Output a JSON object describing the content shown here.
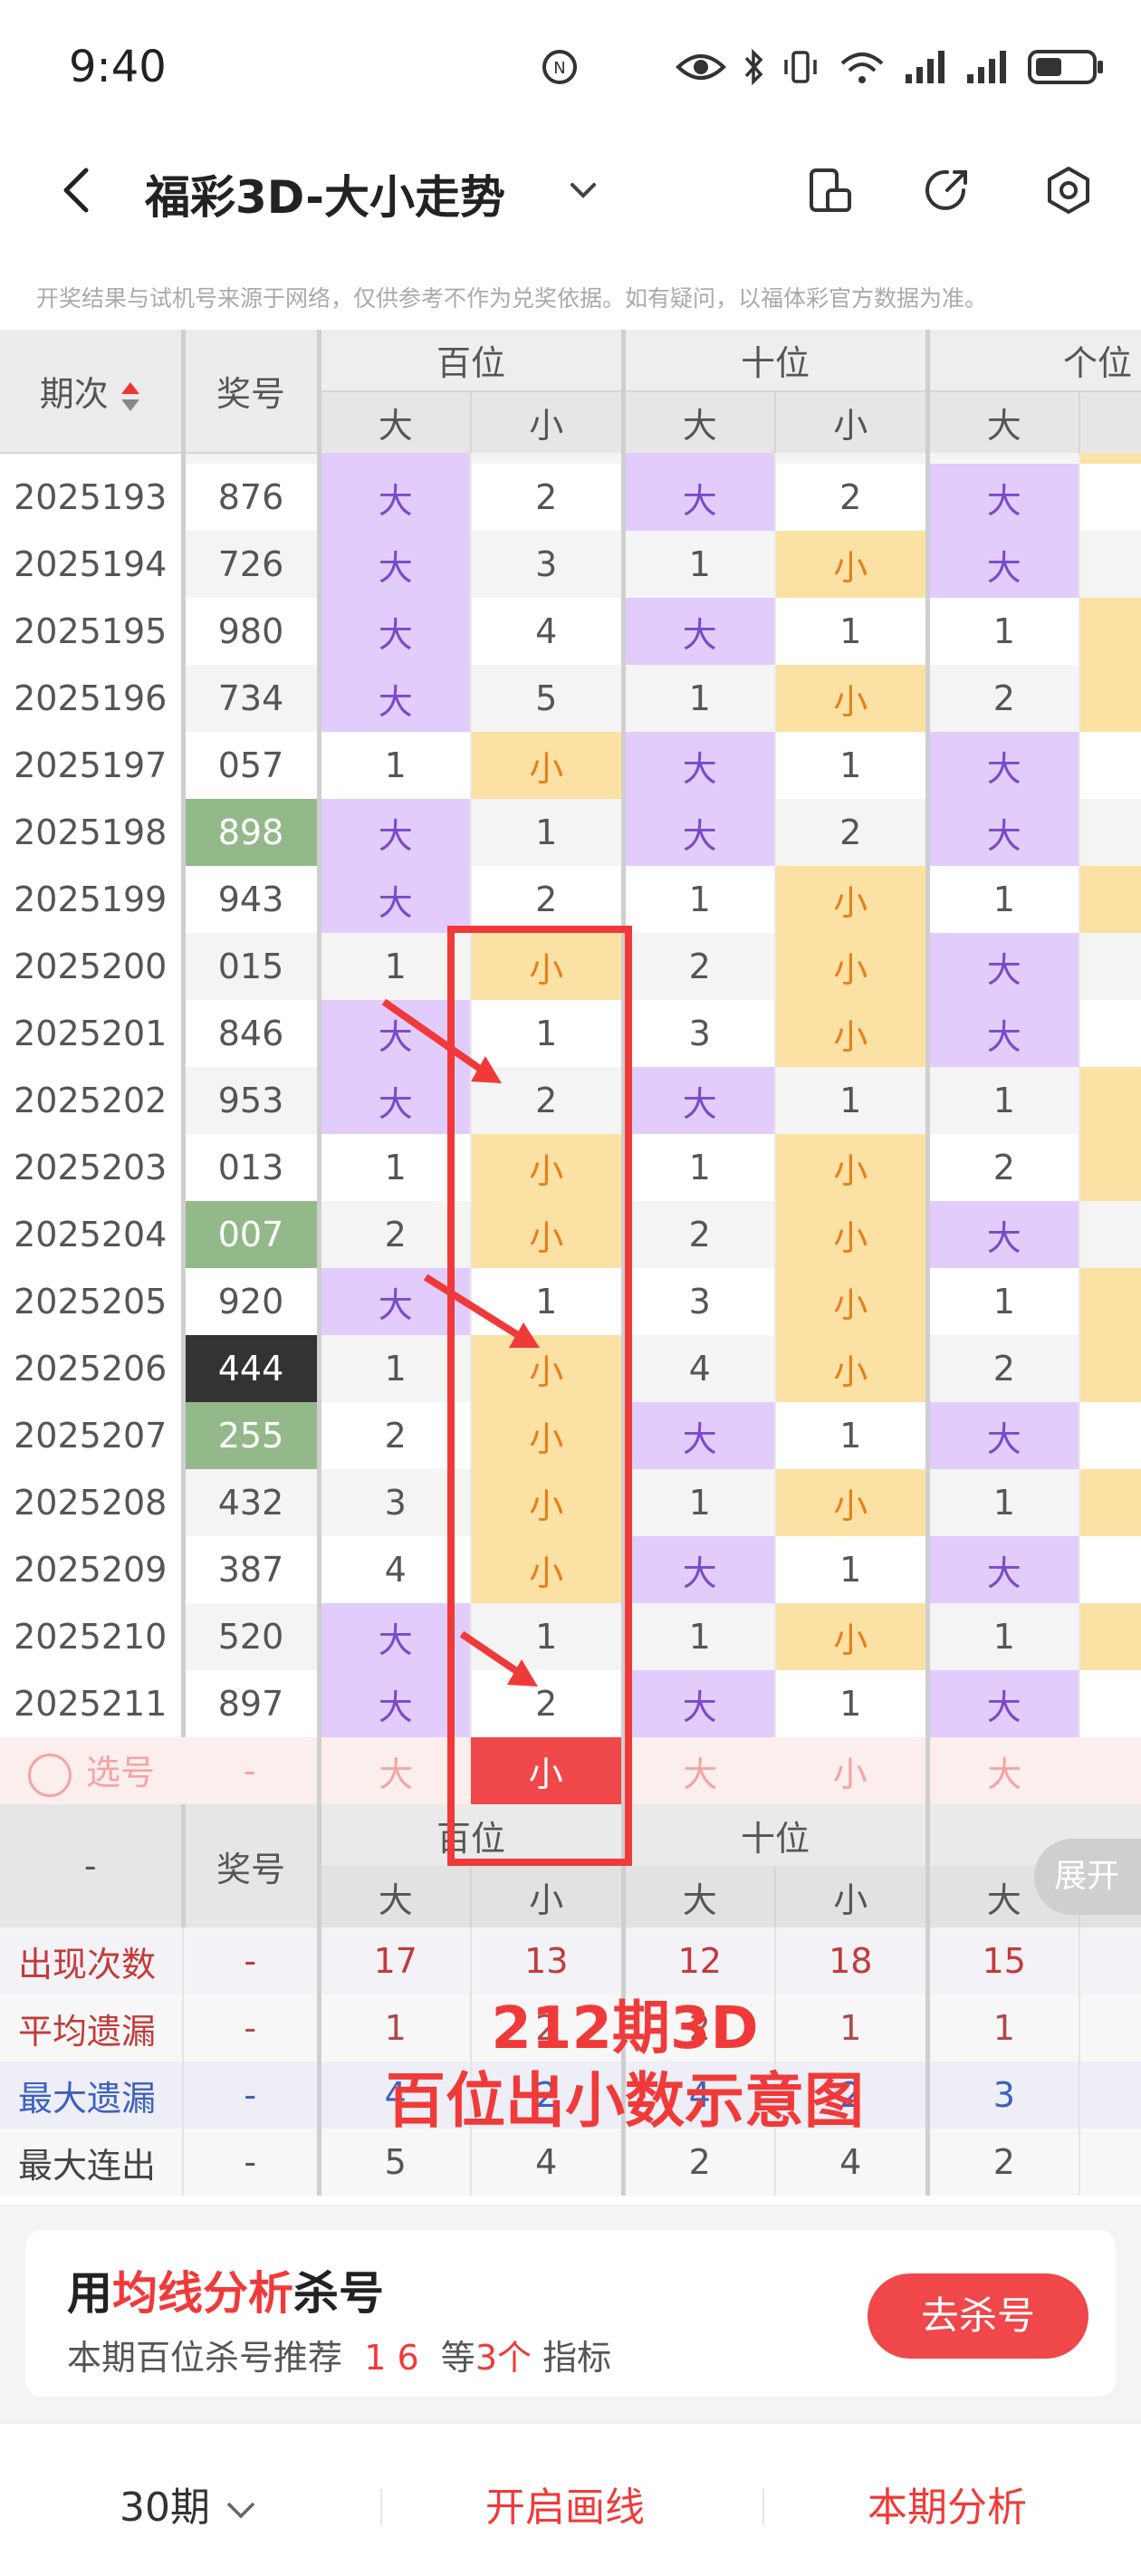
{
  "status_bar": {
    "time": "9:40",
    "battery_icon": "battery-icon",
    "wifi_icon": "wifi-icon"
  },
  "header": {
    "title": "福彩3D-大小走势"
  },
  "disclaimer": "开奖结果与试机号来源于网络，仅供参考不作为兑奖依据。如有疑问，以福体彩官方数据为准。",
  "table": {
    "col_period": "期次",
    "col_number": "奖号",
    "groups": [
      "百位",
      "十位",
      "个位"
    ],
    "sub": [
      "大",
      "小",
      "大",
      "小",
      "大"
    ],
    "rows": [
      {
        "period": "2025193",
        "number": "876",
        "c": [
          "大",
          "2",
          "大",
          "2",
          "大"
        ]
      },
      {
        "period": "2025194",
        "number": "726",
        "c": [
          "大",
          "3",
          "1",
          "小",
          "大"
        ]
      },
      {
        "period": "2025195",
        "number": "980",
        "c": [
          "大",
          "4",
          "大",
          "1",
          "1"
        ]
      },
      {
        "period": "2025196",
        "number": "734",
        "c": [
          "大",
          "5",
          "1",
          "小",
          "2"
        ]
      },
      {
        "period": "2025197",
        "number": "057",
        "c": [
          "1",
          "小",
          "大",
          "1",
          "大"
        ]
      },
      {
        "period": "2025198",
        "number": "898",
        "c": [
          "大",
          "1",
          "大",
          "2",
          "大"
        ]
      },
      {
        "period": "2025199",
        "number": "943",
        "c": [
          "大",
          "2",
          "1",
          "小",
          "1"
        ]
      },
      {
        "period": "2025200",
        "number": "015",
        "c": [
          "1",
          "小",
          "2",
          "小",
          "大"
        ]
      },
      {
        "period": "2025201",
        "number": "846",
        "c": [
          "大",
          "1",
          "3",
          "小",
          "大"
        ]
      },
      {
        "period": "2025202",
        "number": "953",
        "c": [
          "大",
          "2",
          "大",
          "1",
          "1"
        ]
      },
      {
        "period": "2025203",
        "number": "013",
        "c": [
          "1",
          "小",
          "1",
          "小",
          "2"
        ]
      },
      {
        "period": "2025204",
        "number": "007",
        "c": [
          "2",
          "小",
          "2",
          "小",
          "大"
        ]
      },
      {
        "period": "2025205",
        "number": "920",
        "c": [
          "大",
          "1",
          "3",
          "小",
          "1"
        ]
      },
      {
        "period": "2025206",
        "number": "444",
        "c": [
          "1",
          "小",
          "4",
          "小",
          "2"
        ]
      },
      {
        "period": "2025207",
        "number": "255",
        "c": [
          "2",
          "小",
          "大",
          "1",
          "大"
        ]
      },
      {
        "period": "2025208",
        "number": "432",
        "c": [
          "3",
          "小",
          "1",
          "小",
          "1"
        ]
      },
      {
        "period": "2025209",
        "number": "387",
        "c": [
          "4",
          "小",
          "大",
          "1",
          "大"
        ]
      },
      {
        "period": "2025210",
        "number": "520",
        "c": [
          "大",
          "1",
          "1",
          "小",
          "1"
        ]
      },
      {
        "period": "2025211",
        "number": "897",
        "c": [
          "大",
          "2",
          "大",
          "1",
          "大"
        ]
      }
    ],
    "number_highlight": {
      "2025198": "green",
      "2025204": "green",
      "2025207": "green",
      "2025206": "black"
    },
    "pick_row": {
      "label": "选号",
      "number": "-",
      "c": [
        "大",
        "小",
        "大",
        "小",
        "大"
      ]
    },
    "summary_head": {
      "period": "-",
      "number": "奖号",
      "groups": [
        "百位",
        "十位",
        "个位"
      ],
      "sub": [
        "大",
        "小",
        "大",
        "小",
        "大"
      ]
    },
    "stats": [
      {
        "label": "出现次数",
        "number": "-",
        "c": [
          "17",
          "13",
          "12",
          "18",
          "15"
        ]
      },
      {
        "label": "平均遗漏",
        "number": "-",
        "c": [
          "1",
          "2",
          "2",
          "1",
          "1"
        ]
      },
      {
        "label": "最大遗漏",
        "number": "-",
        "c": [
          "4",
          "2",
          "4",
          "2",
          "3"
        ]
      },
      {
        "label": "最大连出",
        "number": "-",
        "c": [
          "5",
          "4",
          "2",
          "4",
          "2"
        ]
      }
    ]
  },
  "expand_button": "展开",
  "annotation": {
    "line1": "212期3D",
    "line2": "百位出小数示意图"
  },
  "promo": {
    "title_prefix": "用",
    "title_highlight": "均线分析",
    "title_suffix": "杀号",
    "sub_prefix": "本期百位杀号推荐",
    "sub_numbers": "1 6",
    "sub_mid": "等",
    "sub_count": "3个",
    "sub_suffix": "指标",
    "button": "去杀号"
  },
  "bottom_bar": {
    "period_select": "30期",
    "draw_line": "开启画线",
    "analysis": "本期分析"
  },
  "colors": {
    "big": "#e2ccfb",
    "small": "#fbe1a4",
    "accent": "#f03a3a",
    "green": "#93b98b"
  }
}
